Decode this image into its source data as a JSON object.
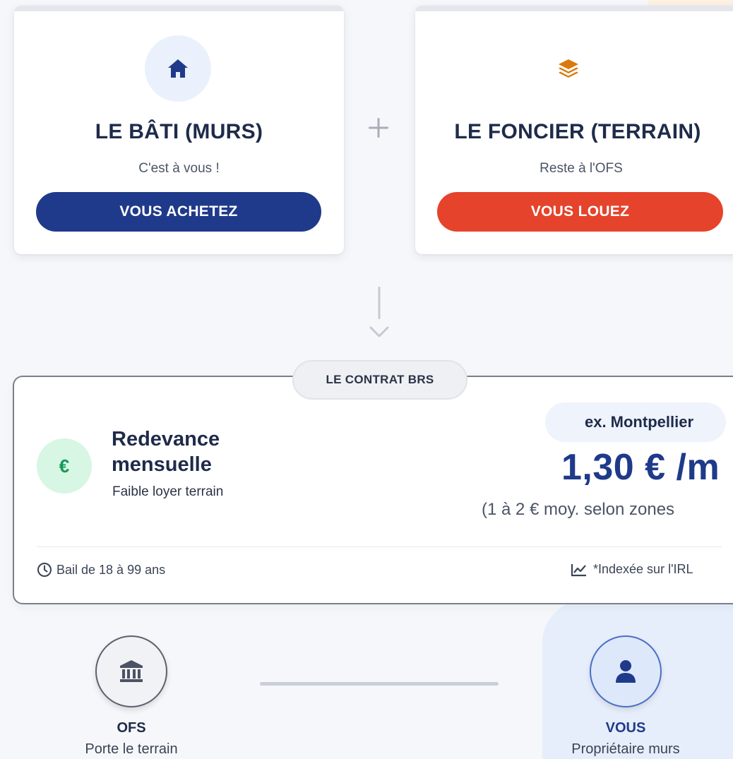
{
  "cards": {
    "bati": {
      "title": "LE BÂTI (MURS)",
      "subtitle": "C'est à vous !",
      "button": "VOUS ACHETEZ",
      "icon": "home-icon",
      "color": "#1f3a8a"
    },
    "foncier": {
      "title": "LE FONCIER (TERRAIN)",
      "subtitle": "Reste à l'OFS",
      "button": "VOUS LOUEZ",
      "icon": "layers-icon",
      "color": "#e5432b"
    }
  },
  "contract": {
    "tag": "LE CONTRAT BRS",
    "redevance_title": "Redevance mensuelle",
    "redevance_sub": "Faible loyer terrain",
    "city": "ex. Montpellier",
    "price": "1,30 € /m",
    "price_range": "(1 à 2 € moy. selon zones",
    "lease": "Bail de 18 à 99 ans",
    "index": "*Indexée sur l'IRL"
  },
  "parties": {
    "ofs": {
      "name": "OFS",
      "role": "Porte le terrain",
      "icon": "bank-icon"
    },
    "you": {
      "name": "VOUS",
      "role": "Propriétaire murs",
      "icon": "user-icon"
    }
  }
}
